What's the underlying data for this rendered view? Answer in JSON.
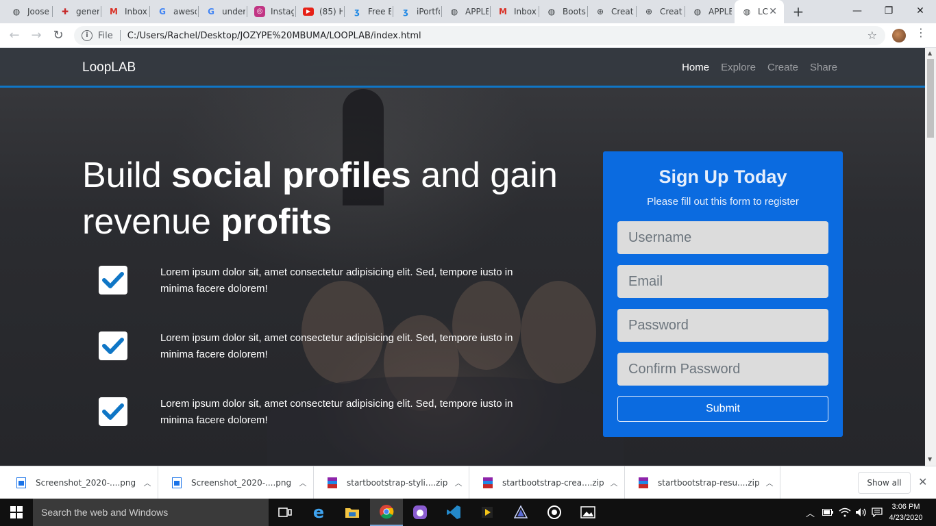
{
  "browser": {
    "tabs": [
      {
        "title": "Joose",
        "icon": "globe-icon"
      },
      {
        "title": "gener",
        "icon": "red-logo-icon"
      },
      {
        "title": "Inbox",
        "icon": "gmail-icon"
      },
      {
        "title": "aweso",
        "icon": "google-icon"
      },
      {
        "title": "under",
        "icon": "google-icon"
      },
      {
        "title": "Instag",
        "icon": "instagram-icon"
      },
      {
        "title": "(85) H",
        "icon": "youtube-icon"
      },
      {
        "title": "Free E",
        "icon": "bolt-icon"
      },
      {
        "title": "iPortfo",
        "icon": "bolt-icon"
      },
      {
        "title": "APPLE",
        "icon": "globe-icon"
      },
      {
        "title": "Inbox",
        "icon": "gmail-icon"
      },
      {
        "title": "Boots",
        "icon": "globe-icon"
      },
      {
        "title": "Creat",
        "icon": "web-icon"
      },
      {
        "title": "Creat",
        "icon": "web-icon"
      },
      {
        "title": "APPLE",
        "icon": "globe-icon"
      },
      {
        "title": "LC",
        "icon": "globe-icon"
      }
    ],
    "scheme": "File",
    "url": "C:/Users/Rachel/Desktop/JOZYPE%20MBUMA/LOOPLAB/index.html"
  },
  "page": {
    "brand": "LoopLAB",
    "nav": {
      "home": "Home",
      "explore": "Explore",
      "create": "Create",
      "share": "Share"
    },
    "headline": {
      "part1": "Build ",
      "bold1": "social profiles",
      "part2": " and gain revenue ",
      "bold2": "profits"
    },
    "features": [
      "Lorem ipsum dolor sit, amet consectetur adipisicing elit. Sed, tempore iusto in minima facere dolorem!",
      "Lorem ipsum dolor sit, amet consectetur adipisicing elit. Sed, tempore iusto in minima facere dolorem!",
      "Lorem ipsum dolor sit, amet consectetur adipisicing elit. Sed, tempore iusto in minima facere dolorem!"
    ],
    "form": {
      "title": "Sign Up Today",
      "subtitle": "Please fill out this form to register",
      "username_placeholder": "Username",
      "email_placeholder": "Email",
      "password_placeholder": "Password",
      "confirm_placeholder": "Confirm Password",
      "submit": "Submit"
    },
    "colors": {
      "accent": "#0b6be0",
      "navbar_border": "#0f76c6",
      "check": "#0f76c6"
    }
  },
  "downloads": {
    "items": [
      "Screenshot_2020-....png",
      "Screenshot_2020-....png",
      "startbootstrap-styli....zip",
      "startbootstrap-crea....zip",
      "startbootstrap-resu....zip"
    ],
    "show_all": "Show all"
  },
  "taskbar": {
    "search_placeholder": "Search the web and Windows",
    "time": "3:06 PM",
    "date": "4/23/2020"
  }
}
